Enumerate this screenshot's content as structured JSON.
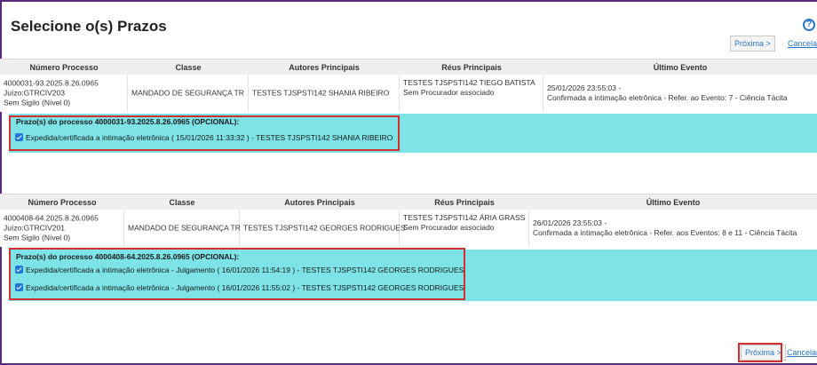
{
  "page": {
    "title": "Selecione o(s) Prazos",
    "help_icon": "?",
    "next_label": "Próxima >",
    "cancel_label": "Cancelar"
  },
  "table_headers": [
    "Número Processo",
    "Classe",
    "Autores Principais",
    "Réus Principais",
    "Último Evento"
  ],
  "processes": [
    {
      "numero": [
        "4000031-93.2025.8.26.0965",
        "Juízo:GTRCIV203",
        "Sem Sigilo (Nível 0)"
      ],
      "classe": "MANDADO DE SEGURANÇA TR",
      "autores": "TESTES TJSPSTI142 SHANIA RIBEIRO",
      "reus": [
        "TESTES TJSPSTI142 TIEGO BATISTA",
        "Sem Procurador associado"
      ],
      "evento": [
        "25/01/2026 23:55:03 -",
        "Confirmada a intimação eletrônica - Refer. ao Evento: 7 - Ciência Tácita"
      ],
      "prazo_title": "Prazo(s) do processo 4000031-93.2025.8.26.0965 (OPCIONAL):",
      "prazos": [
        "Expedida/certificada a intimação eletrônica ( 15/01/2026 11:33:32 ) - TESTES TJSPSTI142 SHANIA RIBEIRO"
      ]
    },
    {
      "numero": [
        "4000408-64.2025.8.26.0965",
        "Juízo:GTRCIV201",
        "Sem Sigilo (Nível 0)"
      ],
      "classe": "MANDADO DE SEGURANÇA TR",
      "autores": "TESTES TJSPSTI142 GEORGES RODRIGUES",
      "reus": [
        "TESTES TJSPSTI142 ÁRIA GRASS",
        "Sem Procurador associado"
      ],
      "evento": [
        "26/01/2026 23:55:03 -",
        "Confirmada a intimação eletrônica - Refer. aos Eventos: 8 e 11 - Ciência Tácita"
      ],
      "prazo_title": "Prazo(s) do processo 4000408-64.2025.8.26.0965 (OPCIONAL):",
      "prazos": [
        "Expedida/certificada a intimação eletrônica - Julgamento ( 16/01/2026 11:54:19 ) - TESTES TJSPSTI142 GEORGES RODRIGUES",
        "Expedida/certificada a intimação eletrônica - Julgamento ( 16/01/2026 11:55:02 ) - TESTES TJSPSTI142 GEORGES RODRIGUES"
      ]
    }
  ],
  "colors": {
    "accent": "#2a78c8",
    "highlight": "#7de3e6",
    "callout": "#d32f2f",
    "checkbox": "#1e78d7"
  }
}
